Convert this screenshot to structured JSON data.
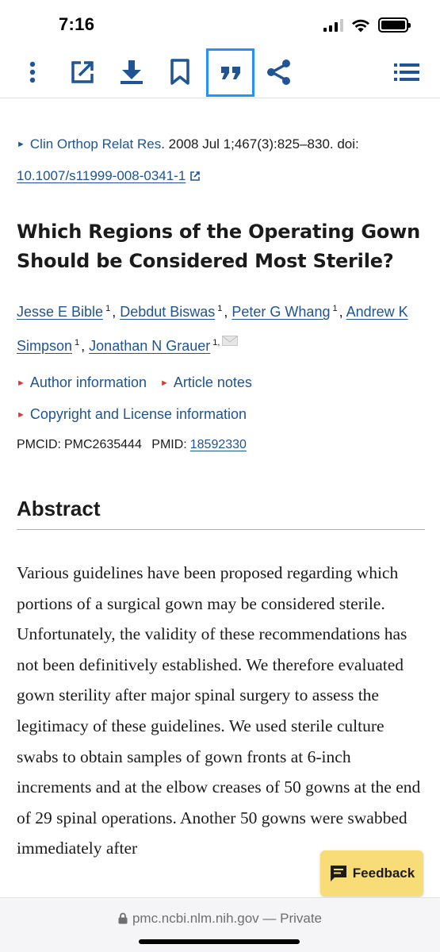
{
  "status_bar": {
    "time": "7:16"
  },
  "toolbar": {
    "buttons": [
      "more-options",
      "open-external",
      "download",
      "bookmark",
      "cite",
      "share",
      "table-of-contents"
    ],
    "accent_color": "#205493",
    "active_outline_color": "#2491ff"
  },
  "citation": {
    "journal": "Clin Orthop Relat Res",
    "details": ". 2008 Jul 1;467(3):825–830. doi:",
    "doi": "10.1007/s11999-008-0341-1"
  },
  "article": {
    "title": "Which Regions of the Operating Gown Should be Considered Most Sterile?",
    "authors": [
      {
        "name": "Jesse E Bible",
        "aff": "1"
      },
      {
        "name": "Debdut Biswas",
        "aff": "1"
      },
      {
        "name": "Peter G Whang",
        "aff": "1"
      },
      {
        "name": "Andrew K Simpson",
        "aff": "1"
      },
      {
        "name": "Jonathan N Grauer",
        "aff": "1,"
      }
    ]
  },
  "links": {
    "author_info": "Author information",
    "article_notes": "Article notes",
    "copyright": "Copyright and License information"
  },
  "ids": {
    "pmcid_label": "PMCID:",
    "pmcid": "PMC2635444",
    "pmid_label": "PMID:",
    "pmid": "18592330"
  },
  "abstract": {
    "heading": "Abstract",
    "text": "Various guidelines have been proposed regarding which portions of a surgical gown may be considered sterile. Unfortunately, the validity of these recommendations has not been definitively established. We therefore evaluated gown sterility after major spinal surgery to assess the legitimacy of these guidelines. We used sterile culture swabs to obtain samples of gown fronts at 6-inch increments and at the elbow creases of 50 gowns at the end of 29 spinal operations. Another 50 gowns were swabbed immediately after"
  },
  "feedback": {
    "label": "Feedback",
    "bg": "#f8dc78"
  },
  "address_bar": {
    "domain": "pmc.ncbi.nlm.nih.gov",
    "suffix": " — Private"
  }
}
